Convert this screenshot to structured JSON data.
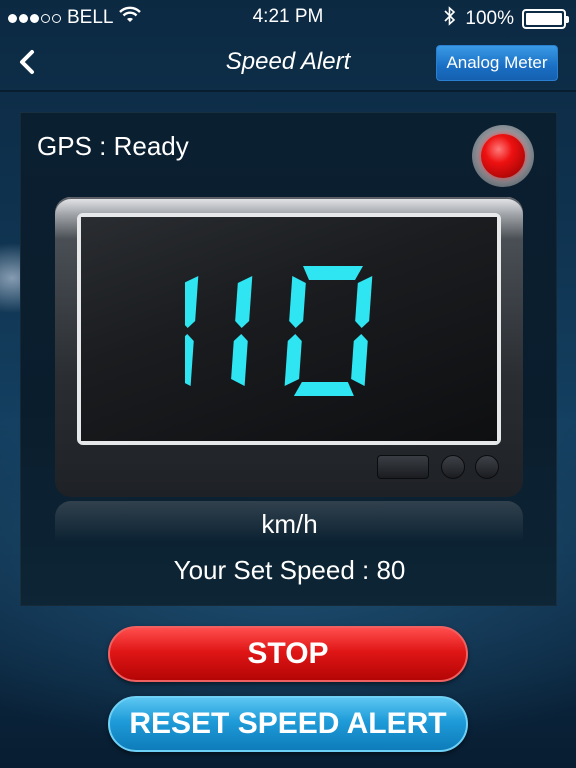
{
  "status_bar": {
    "carrier": "BELL",
    "time": "4:21 PM",
    "battery": "100%",
    "signal_bars": 3,
    "signal_total": 5,
    "battery_level": 1.0
  },
  "nav": {
    "title": "Speed Alert",
    "analog_button": "Analog Meter",
    "back_icon": "chevron-left-icon"
  },
  "panel": {
    "gps_status": "GPS : Ready",
    "speed": "110",
    "unit": "km/h",
    "set_speed": "Your Set Speed : 80",
    "led_color": "#ee1111",
    "digit_color": "#2fe5f2"
  },
  "buttons": {
    "stop": "STOP",
    "reset": "RESET SPEED ALERT"
  }
}
